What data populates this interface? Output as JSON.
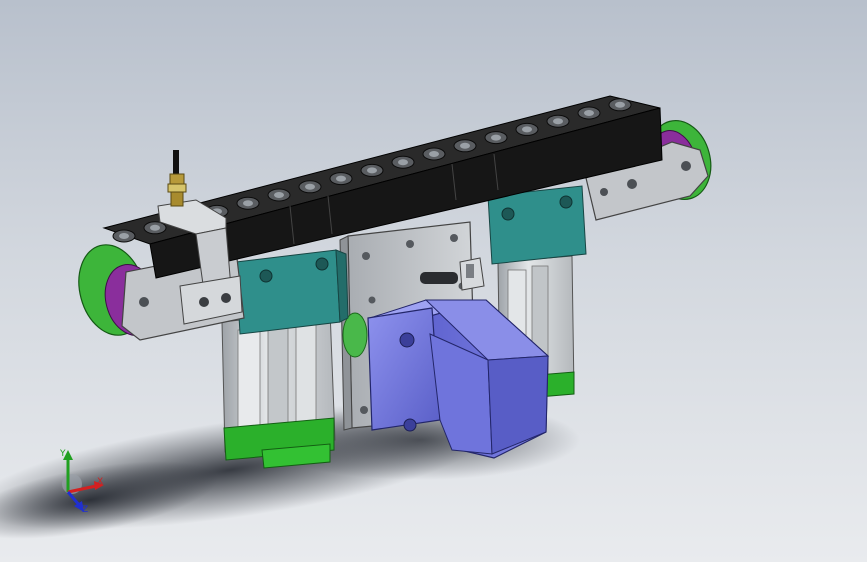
{
  "viewport": {
    "background_top": "#b8c0cc",
    "background_bottom": "#e9ebee"
  },
  "triad": {
    "x_label": "X",
    "y_label": "Y",
    "z_label": "Z",
    "x_color": "#d42020",
    "y_color": "#20a020",
    "z_color": "#2030d0"
  },
  "colors": {
    "belt_black": "#1c1c1c",
    "plate_gray": "#b9bcc0",
    "teal_block": "#2f8f8b",
    "green_pulley": "#3db53a",
    "purple_side": "#8a2e9c",
    "motor_blue": "#6a6fd8",
    "aluminum": "#cfd3d6"
  },
  "model": {
    "icons": [
      "conveyor-belt-icon",
      "stepper-motor-icon",
      "proximity-sensor-icon"
    ]
  }
}
